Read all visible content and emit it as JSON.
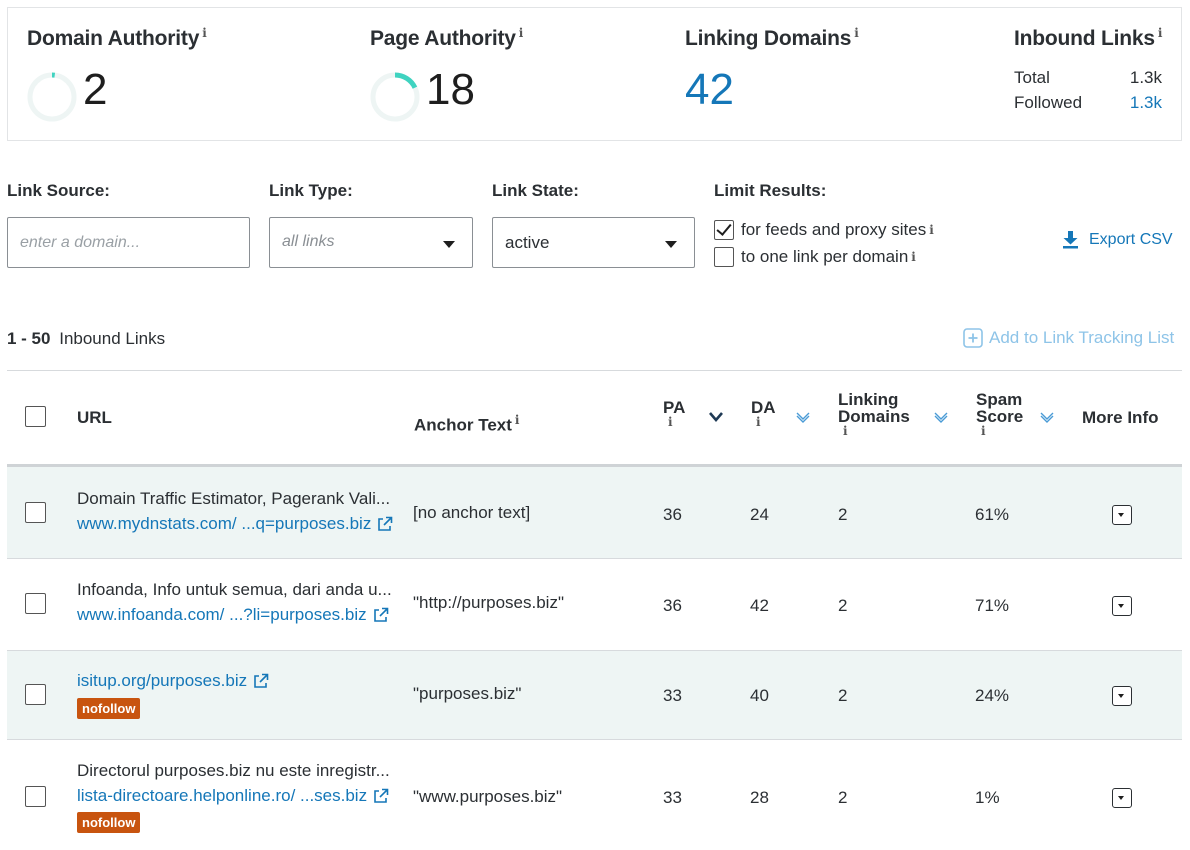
{
  "metrics": {
    "domain_authority": {
      "label": "Domain Authority",
      "info": "i",
      "value": "2",
      "gauge_fraction": 0.02
    },
    "page_authority": {
      "label": "Page Authority",
      "info": "i",
      "value": "18",
      "gauge_fraction": 0.18
    },
    "linking_domains": {
      "label": "Linking Domains",
      "info": "i",
      "value": "42"
    },
    "inbound_links": {
      "label": "Inbound Links",
      "info": "i",
      "total_label": "Total",
      "total_value": "1.3k",
      "followed_label": "Followed",
      "followed_value": "1.3k"
    }
  },
  "filters": {
    "link_source": {
      "label": "Link Source:",
      "placeholder": "enter a domain..."
    },
    "link_type": {
      "label": "Link Type:",
      "value": "all links"
    },
    "link_state": {
      "label": "Link State:",
      "value": "active"
    },
    "limit_results": {
      "label": "Limit Results:",
      "options": [
        {
          "label": "for feeds and proxy sites",
          "info": "i",
          "checked": true
        },
        {
          "label": "to one link per domain",
          "info": "i",
          "checked": false
        }
      ]
    },
    "export_label": "Export CSV"
  },
  "results": {
    "range": "1 - 50",
    "range_label": "Inbound Links",
    "add_tracking_label": "Add to Link Tracking List"
  },
  "table": {
    "headers": {
      "url": "URL",
      "anchor": "Anchor Text",
      "pa": "PA",
      "da": "DA",
      "linking_line1": "Linking",
      "linking_line2": "Domains",
      "spam_line1": "Spam",
      "spam_line2": "Score",
      "more": "More Info",
      "info": "i"
    },
    "rows": [
      {
        "title": "Domain Traffic Estimator, Pagerank Vali...",
        "url": "www.mydnstats.com/ ...q=purposes.biz",
        "nofollow": "",
        "anchor": "[no anchor text]",
        "pa": "36",
        "da": "24",
        "linking": "2",
        "spam": "61%"
      },
      {
        "title": "Infoanda, Info untuk semua, dari anda u...",
        "url": "www.infoanda.com/ ...?li=purposes.biz",
        "nofollow": "",
        "anchor": "\"http://purposes.biz\"",
        "pa": "36",
        "da": "42",
        "linking": "2",
        "spam": "71%"
      },
      {
        "title": "",
        "url": "isitup.org/purposes.biz",
        "nofollow": "nofollow",
        "anchor": "\"purposes.biz\"",
        "pa": "33",
        "da": "40",
        "linking": "2",
        "spam": "24%"
      },
      {
        "title": "Directorul purposes.biz nu este inregistr...",
        "url": "lista-directoare.helponline.ro/ ...ses.biz",
        "nofollow": "nofollow",
        "anchor": "\"www.purposes.biz\"",
        "pa": "33",
        "da": "28",
        "linking": "2",
        "spam": "1%"
      }
    ]
  },
  "colors": {
    "link_blue": "#1577b8",
    "gauge_teal": "#3fd3c0",
    "nofollow_orange": "#c8540f",
    "row_shade": "#eef5f4"
  }
}
